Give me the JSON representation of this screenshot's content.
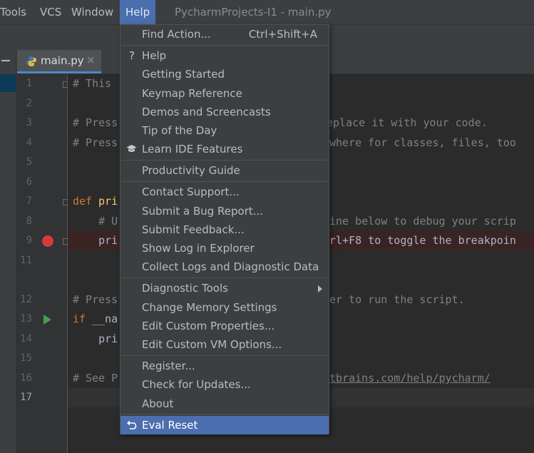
{
  "menubar": {
    "items": [
      "Tools",
      "VCS",
      "Window",
      "Help"
    ],
    "active": "Help",
    "project_title": "PycharmProjects-I1 - main.py"
  },
  "tab": {
    "filename": "main.py",
    "close": "×"
  },
  "gutter": {
    "line_numbers": [
      "1",
      "2",
      "3",
      "4",
      "5",
      "6",
      "7",
      "8",
      "9",
      "11",
      "12",
      "13",
      "14",
      "15",
      "16",
      "17"
    ],
    "current_line": "17"
  },
  "editor": {
    "lines": [
      {
        "n": "1",
        "text": "# This"
      },
      {
        "n": "2",
        "text": ""
      },
      {
        "n": "3",
        "text": "# Press",
        "tail": "eplace it with your code."
      },
      {
        "n": "4",
        "text": "# Press",
        "tail": "where for classes, files, too"
      },
      {
        "n": "5",
        "text": ""
      },
      {
        "n": "6",
        "text": ""
      },
      {
        "n": "7",
        "kw": "def",
        "fn": " pri"
      },
      {
        "n": "8",
        "text": "    # U",
        "tail": "ine below to debug your scrip"
      },
      {
        "n": "9",
        "text": "    pri",
        "tail": "rl+F8 to toggle the breakpoin"
      },
      {
        "n": "11",
        "text": ""
      },
      {
        "n": "12",
        "text": "# Press",
        "tail": "er to run the script."
      },
      {
        "n": "13",
        "kw": "if",
        "text": " __na"
      },
      {
        "n": "14",
        "text": "    pri"
      },
      {
        "n": "15",
        "text": ""
      },
      {
        "n": "16",
        "text": "# See P",
        "url": "tbrains.com/help/pycharm/"
      },
      {
        "n": "17",
        "text": ""
      }
    ]
  },
  "help_menu": {
    "find_action": {
      "label": "Find Action...",
      "shortcut": "Ctrl+Shift+A"
    },
    "group1": [
      {
        "label": "Help",
        "icon": "?"
      },
      {
        "label": "Getting Started"
      },
      {
        "label": "Keymap Reference"
      },
      {
        "label": "Demos and Screencasts"
      },
      {
        "label": "Tip of the Day"
      },
      {
        "label": "Learn IDE Features",
        "icon": "graduation-cap-icon"
      }
    ],
    "productivity": "Productivity Guide",
    "group2": [
      "Contact Support...",
      "Submit a Bug Report...",
      "Submit Feedback...",
      "Show Log in Explorer",
      "Collect Logs and Diagnostic Data"
    ],
    "group3": [
      "Diagnostic Tools",
      "Change Memory Settings",
      "Edit Custom Properties...",
      "Edit Custom VM Options..."
    ],
    "group4": [
      "Register...",
      "Check for Updates...",
      "About"
    ],
    "eval_reset": "Eval Reset",
    "colors": {
      "selection": "#4b6eaf",
      "menu_bg": "#3c3f41"
    }
  }
}
